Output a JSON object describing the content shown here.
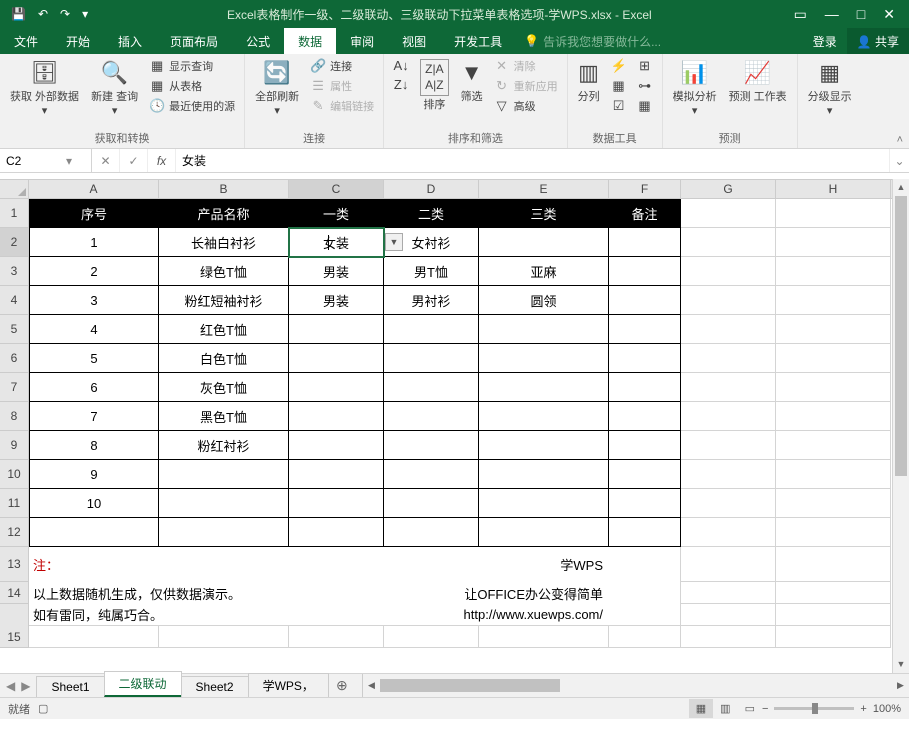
{
  "title": "Excel表格制作一级、二级联动、三级联动下拉菜单表格选项-学WPS.xlsx - Excel",
  "window": {
    "login": "登录",
    "share": "共享"
  },
  "tabs": [
    "文件",
    "开始",
    "插入",
    "页面布局",
    "公式",
    "数据",
    "审阅",
    "视图",
    "开发工具"
  ],
  "active_tab": "数据",
  "tell_me": "告诉我您想要做什么...",
  "ribbon": {
    "g1": {
      "label": "获取和转换",
      "buttons": {
        "ext": "获取\n外部数据",
        "newq": "新建\n查询",
        "showq": "显示查询",
        "fromtbl": "从表格",
        "recent": "最近使用的源"
      }
    },
    "g2": {
      "label": "连接",
      "buttons": {
        "refresh": "全部刷新",
        "conn": "连接",
        "prop": "属性",
        "editlink": "编辑链接"
      }
    },
    "g3": {
      "label": "排序和筛选",
      "buttons": {
        "az": "A↓Z",
        "za": "Z↓A",
        "sort": "排序",
        "filter": "筛选",
        "clear": "清除",
        "reapply": "重新应用",
        "adv": "高级"
      }
    },
    "g4": {
      "label": "数据工具",
      "buttons": {
        "split": "分列"
      }
    },
    "g5": {
      "label": "预测",
      "buttons": {
        "whatif": "模拟分析",
        "forecast": "预测\n工作表"
      }
    },
    "g6": {
      "buttons": {
        "outline": "分级显示"
      }
    }
  },
  "namebox": "C2",
  "formula": "女装",
  "columns": [
    "A",
    "B",
    "C",
    "D",
    "E",
    "F",
    "G",
    "H"
  ],
  "headers": {
    "A": "序号",
    "B": "产品名称",
    "C": "一类",
    "D": "二类",
    "E": "三类",
    "F": "备注"
  },
  "data": [
    {
      "A": "1",
      "B": "长袖白衬衫",
      "C": "女装",
      "D": "女衬衫",
      "E": "",
      "F": ""
    },
    {
      "A": "2",
      "B": "绿色T恤",
      "C": "男装",
      "D": "男T恤",
      "E": "亚麻",
      "F": ""
    },
    {
      "A": "3",
      "B": "粉红短袖衬衫",
      "C": "男装",
      "D": "男衬衫",
      "E": "圆领",
      "F": ""
    },
    {
      "A": "4",
      "B": "红色T恤",
      "C": "",
      "D": "",
      "E": "",
      "F": ""
    },
    {
      "A": "5",
      "B": "白色T恤",
      "C": "",
      "D": "",
      "E": "",
      "F": ""
    },
    {
      "A": "6",
      "B": "灰色T恤",
      "C": "",
      "D": "",
      "E": "",
      "F": ""
    },
    {
      "A": "7",
      "B": "黑色T恤",
      "C": "",
      "D": "",
      "E": "",
      "F": ""
    },
    {
      "A": "8",
      "B": "粉红衬衫",
      "C": "",
      "D": "",
      "E": "",
      "F": ""
    },
    {
      "A": "9",
      "B": "",
      "C": "",
      "D": "",
      "E": "",
      "F": ""
    },
    {
      "A": "10",
      "B": "",
      "C": "",
      "D": "",
      "E": "",
      "F": ""
    }
  ],
  "selected_cell_display": "女装",
  "notes": {
    "title": "注：",
    "line1": "以上数据随机生成，仅供数据演示。",
    "line2": "如有雷同，纯属巧合。",
    "r1": "学WPS",
    "r2": "让OFFICE办公变得简单",
    "r3": "http://www.xuewps.com/"
  },
  "sheets": [
    "Sheet1",
    "二级联动",
    "Sheet2",
    "学WPS，"
  ],
  "active_sheet": "二级联动",
  "status": {
    "ready": "就绪",
    "zoom": "100%"
  }
}
